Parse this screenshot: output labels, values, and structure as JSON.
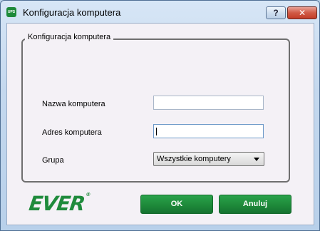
{
  "window": {
    "title": "Konfiguracja komputera",
    "app_icon_text": "UPS",
    "help_label": "?",
    "close_label": "✕"
  },
  "group": {
    "title": "Konfiguracja komputera"
  },
  "form": {
    "name_label": "Nazwa komputera",
    "name_value": "",
    "address_label": "Adres komputera",
    "address_value": "",
    "group_label": "Grupa",
    "group_selected": "Wszystkie komputery"
  },
  "brand": {
    "logo_text": "EVER",
    "logo_mark": "®",
    "color": "#1e8a3a"
  },
  "buttons": {
    "ok_label": "OK",
    "cancel_label": "Anuluj"
  }
}
